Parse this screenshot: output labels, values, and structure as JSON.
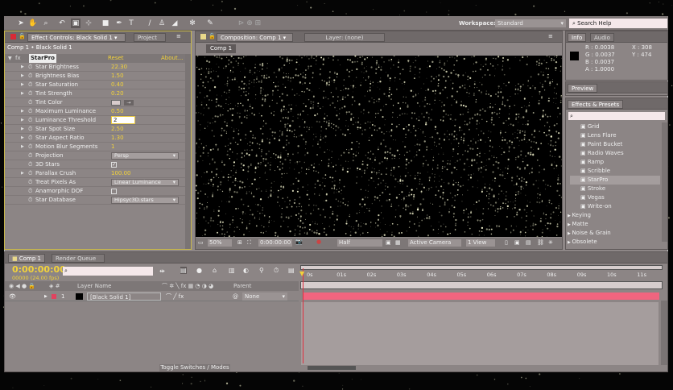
{
  "toolbar": {
    "icons": [
      "selection-tool",
      "hand-tool",
      "zoom-tool",
      "rotate-tool",
      "camera-tool",
      "pan-behind-tool",
      "rectangle-tool",
      "pen-tool",
      "text-tool",
      "brush-tool",
      "clone-stamp-tool",
      "eraser-tool",
      "roto-brush-tool",
      "puppet-tool"
    ],
    "workspace_label": "Workspace:",
    "workspace_value": "Standard",
    "search_help": "Search Help"
  },
  "effect_controls": {
    "tab": "Effect Controls: Black Solid 1",
    "project_tab": "Project",
    "breadcrumb": "Comp 1 • Black Solid 1",
    "effect_name": "StarPro",
    "reset": "Reset",
    "about": "About...",
    "params": [
      {
        "label": "Star Brightness",
        "value": "22.30",
        "expand": true
      },
      {
        "label": "Brightness Bias",
        "value": "1.50",
        "expand": true
      },
      {
        "label": "Star Saturation",
        "value": "0.40",
        "expand": true
      },
      {
        "label": "Tint Strength",
        "value": "0.20",
        "expand": true
      },
      {
        "label": "Tint Color",
        "value": "",
        "expand": false
      },
      {
        "label": "Maximum Luminance",
        "value": "0.50",
        "expand": true
      },
      {
        "label": "Luminance Threshold",
        "value": "2",
        "expand": true
      },
      {
        "label": "Star Spot Size",
        "value": "2.50",
        "expand": true
      },
      {
        "label": "Star Aspect Ratio",
        "value": "1.30",
        "expand": true
      },
      {
        "label": "Motion Blur Segments",
        "value": "1",
        "expand": true
      },
      {
        "label": "Projection",
        "value": "Persp",
        "expand": false
      },
      {
        "label": "3D Stars",
        "value": "✓",
        "expand": false
      },
      {
        "label": "Parallax Crush",
        "value": "100.00",
        "expand": true
      },
      {
        "label": "Treat Pixels As",
        "value": "Linear Luminance",
        "expand": false
      },
      {
        "label": "Anamorphic DOF",
        "value": "",
        "expand": false
      },
      {
        "label": "Star Database",
        "value": "Hipsyc3D.stars",
        "expand": false
      }
    ]
  },
  "composition": {
    "tab": "Composition: Comp 1",
    "layer_tab": "Layer: (none)",
    "chip": "Comp 1",
    "zoom": "50%",
    "timecode": "0:00:00:00",
    "resolution": "Half",
    "camera": "Active Camera",
    "views": "1 View"
  },
  "info": {
    "tab": "Info",
    "audio_tab": "Audio",
    "r": "R : 0.0038",
    "g": "G : 0.0037",
    "b": "B : 0.0037",
    "a": "A : 1.0000",
    "x": "X : 308",
    "y": "Y : 474"
  },
  "preview": {
    "tab": "Preview"
  },
  "effects_presets": {
    "tab": "Effects & Presets",
    "search_value": "",
    "items": [
      "Grid",
      "Lens Flare",
      "Paint Bucket",
      "Radio Waves",
      "Ramp",
      "Scribble",
      "StarPro",
      "Stroke",
      "Vegas",
      "Write-on"
    ],
    "selected": "StarPro",
    "categories": [
      "Keying",
      "Matte",
      "Noise & Grain",
      "Obsolete"
    ]
  },
  "timeline": {
    "tab": "Comp 1",
    "render_tab": "Render Queue",
    "timecode": "0:00:00:00",
    "frames": "00000 (24.00 fps)",
    "col_layer_name": "Layer Name",
    "col_parent": "Parent",
    "layer_number": "1",
    "layer_name": "[Black Solid 1]",
    "parent": "None",
    "toggle": "Toggle Switches / Modes",
    "ticks": [
      "0s",
      "01s",
      "02s",
      "03s",
      "04s",
      "05s",
      "06s",
      "07s",
      "08s",
      "09s",
      "10s",
      "11s"
    ],
    "layer_color": "#e0435f",
    "bar_color": "#f0657f"
  }
}
